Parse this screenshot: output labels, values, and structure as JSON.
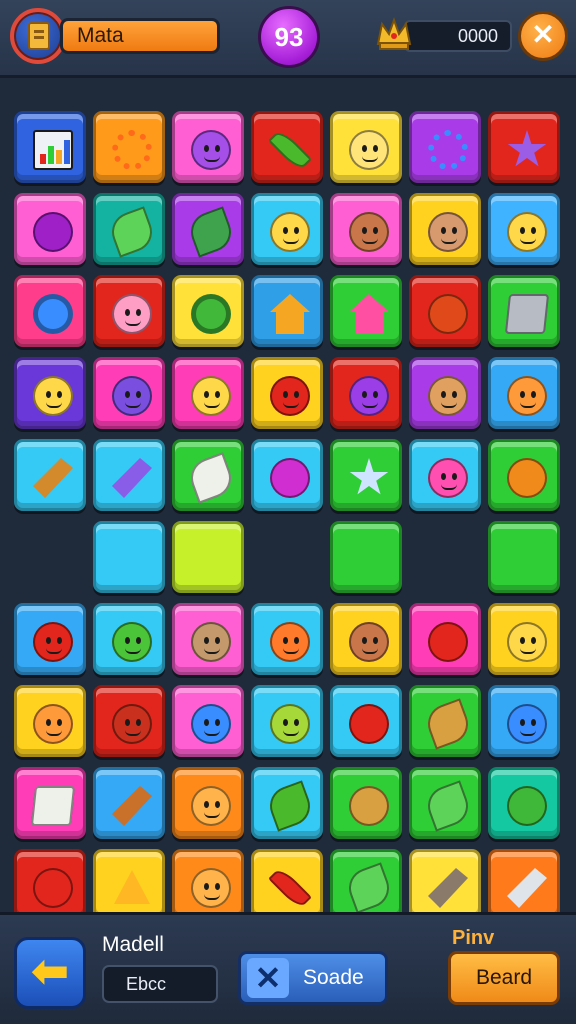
{
  "header": {
    "player_name": "Mata",
    "score": "93",
    "coins": "0000",
    "close_icon": "close-icon",
    "crown_icon": "crown-icon",
    "avatar_icon": "book-icon"
  },
  "board": {
    "columns": 7,
    "rows": [
      [
        {
          "color": "#2f63e0",
          "item": "chart",
          "fill": "#eef2f7"
        },
        {
          "color": "#ff9a1a",
          "item": "gear",
          "fill": "#ff6a1a"
        },
        {
          "color": "#ff5fd2",
          "item": "face",
          "fill": "#a64ee8"
        },
        {
          "color": "#e2261d",
          "item": "carrot",
          "fill": "#4bb92c"
        },
        {
          "color": "#ffe13a",
          "item": "face",
          "fill": "#ffe47a"
        },
        {
          "color": "#a93ce8",
          "item": "gear",
          "fill": "#3a8dff"
        },
        {
          "color": "#e2261d",
          "item": "star",
          "fill": "#9b5de5"
        }
      ],
      [
        {
          "color": "#ff5fd2",
          "item": "round",
          "fill": "#a020c8"
        },
        {
          "color": "#14b3a1",
          "item": "leaf",
          "fill": "#5ed35a"
        },
        {
          "color": "#a93ce8",
          "item": "leaf",
          "fill": "#3fa34d"
        },
        {
          "color": "#35c9f5",
          "item": "face",
          "fill": "#ffd84a"
        },
        {
          "color": "#ff5fd2",
          "item": "face",
          "fill": "#c9774a"
        },
        {
          "color": "#ffd21f",
          "item": "face",
          "fill": "#d79a6e"
        },
        {
          "color": "#3fb3ff",
          "item": "face",
          "fill": "#ffd84a"
        }
      ],
      [
        {
          "color": "#ff3d8b",
          "item": "swirl",
          "fill": "#3a8dff"
        },
        {
          "color": "#e2261d",
          "item": "face",
          "fill": "#ff9ec5"
        },
        {
          "color": "#ffe13a",
          "item": "swirl",
          "fill": "#41b83a"
        },
        {
          "color": "#2f9fe8",
          "item": "house",
          "fill": "#f5a623"
        },
        {
          "color": "#2fce36",
          "item": "house",
          "fill": "#ff4fa3"
        },
        {
          "color": "#e2261d",
          "item": "round",
          "fill": "#e04a1a"
        },
        {
          "color": "#2fce36",
          "item": "cube",
          "fill": "#b7bcc4"
        }
      ],
      [
        {
          "color": "#6a38d8",
          "item": "face",
          "fill": "#ffd84a"
        },
        {
          "color": "#ff3db7",
          "item": "face",
          "fill": "#7a4fe0"
        },
        {
          "color": "#ff3db7",
          "item": "face",
          "fill": "#ffd84a"
        },
        {
          "color": "#ffd21f",
          "item": "face",
          "fill": "#e2261d"
        },
        {
          "color": "#e2261d",
          "item": "face",
          "fill": "#9b3ee8"
        },
        {
          "color": "#a93ce8",
          "item": "face",
          "fill": "#e0a060"
        },
        {
          "color": "#35a9f5",
          "item": "face",
          "fill": "#ff9a3a"
        }
      ],
      [
        {
          "color": "#35c9f5",
          "item": "shard",
          "fill": "#d28a2c"
        },
        {
          "color": "#35c9f5",
          "item": "shard",
          "fill": "#8a5de8"
        },
        {
          "color": "#2fce36",
          "item": "leaf",
          "fill": "#eef0ea"
        },
        {
          "color": "#35c9f5",
          "item": "round",
          "fill": "#d02ed0"
        },
        {
          "color": "#2fce36",
          "item": "star",
          "fill": "#cfe4ff"
        },
        {
          "color": "#35c9f5",
          "item": "face",
          "fill": "#ff4fb0"
        },
        {
          "color": "#2fce36",
          "item": "round",
          "fill": "#f08a1a"
        }
      ],
      [
        null,
        {
          "color": "#35c9f5",
          "item": "none",
          "fill": ""
        },
        {
          "color": "#c6f02a",
          "item": "none",
          "fill": ""
        },
        null,
        {
          "color": "#2fce36",
          "item": "none",
          "fill": ""
        },
        null,
        {
          "color": "#2fce36",
          "item": "none",
          "fill": ""
        }
      ],
      [
        {
          "color": "#35a9f5",
          "item": "face",
          "fill": "#e2261d"
        },
        {
          "color": "#35c9f5",
          "item": "face",
          "fill": "#4bc43a"
        },
        {
          "color": "#ff5fd2",
          "item": "face",
          "fill": "#c49a6c"
        },
        {
          "color": "#35c9f5",
          "item": "face",
          "fill": "#ff7a2a"
        },
        {
          "color": "#ffd21f",
          "item": "face",
          "fill": "#c9774a"
        },
        {
          "color": "#ff3db7",
          "item": "round",
          "fill": "#e2261d"
        },
        {
          "color": "#ffd21f",
          "item": "face",
          "fill": "#ffd84a"
        }
      ],
      [
        {
          "color": "#ffd21f",
          "item": "face",
          "fill": "#ff9a3a"
        },
        {
          "color": "#e2261d",
          "item": "face",
          "fill": "#c9301d"
        },
        {
          "color": "#ff5fd2",
          "item": "face",
          "fill": "#3a8dff"
        },
        {
          "color": "#35c9f5",
          "item": "face",
          "fill": "#a7d83a"
        },
        {
          "color": "#35c9f5",
          "item": "round",
          "fill": "#e2261d"
        },
        {
          "color": "#2fce36",
          "item": "leaf",
          "fill": "#d8a040"
        },
        {
          "color": "#35a9f5",
          "item": "face",
          "fill": "#3a8dff"
        }
      ],
      [
        {
          "color": "#ff3db7",
          "item": "cube",
          "fill": "#eef0ea"
        },
        {
          "color": "#35a9f5",
          "item": "shard",
          "fill": "#c9702a"
        },
        {
          "color": "#ff8a1a",
          "item": "face",
          "fill": "#ffb34a"
        },
        {
          "color": "#35c9f5",
          "item": "leaf",
          "fill": "#4bb92c"
        },
        {
          "color": "#2fce36",
          "item": "round",
          "fill": "#d8a040"
        },
        {
          "color": "#2fce36",
          "item": "leaf",
          "fill": "#5ed35a"
        },
        {
          "color": "#14c9a1",
          "item": "round",
          "fill": "#3fb83a"
        }
      ],
      [
        {
          "color": "#e2261d",
          "item": "round",
          "fill": "#e2261d"
        },
        {
          "color": "#ffd21f",
          "item": "tri",
          "fill": "#ffb823"
        },
        {
          "color": "#ff8a1a",
          "item": "face",
          "fill": "#ffb34a"
        },
        {
          "color": "#ffd21f",
          "item": "carrot",
          "fill": "#e2261d"
        },
        {
          "color": "#2fce36",
          "item": "leaf",
          "fill": "#5ed35a"
        },
        {
          "color": "#ffe13a",
          "item": "shard",
          "fill": "#8a7a6a"
        },
        {
          "color": "#ff7a1a",
          "item": "shard",
          "fill": "#dfe4ea"
        }
      ]
    ]
  },
  "footer": {
    "back_icon": "arrow-left-icon",
    "mode_label": "Madell",
    "mode_value": "Ebcc",
    "scode_icon": "x-cross-icon",
    "scode_label": "Soade",
    "pinv_label": "Pinv",
    "board_label": "Beard"
  }
}
